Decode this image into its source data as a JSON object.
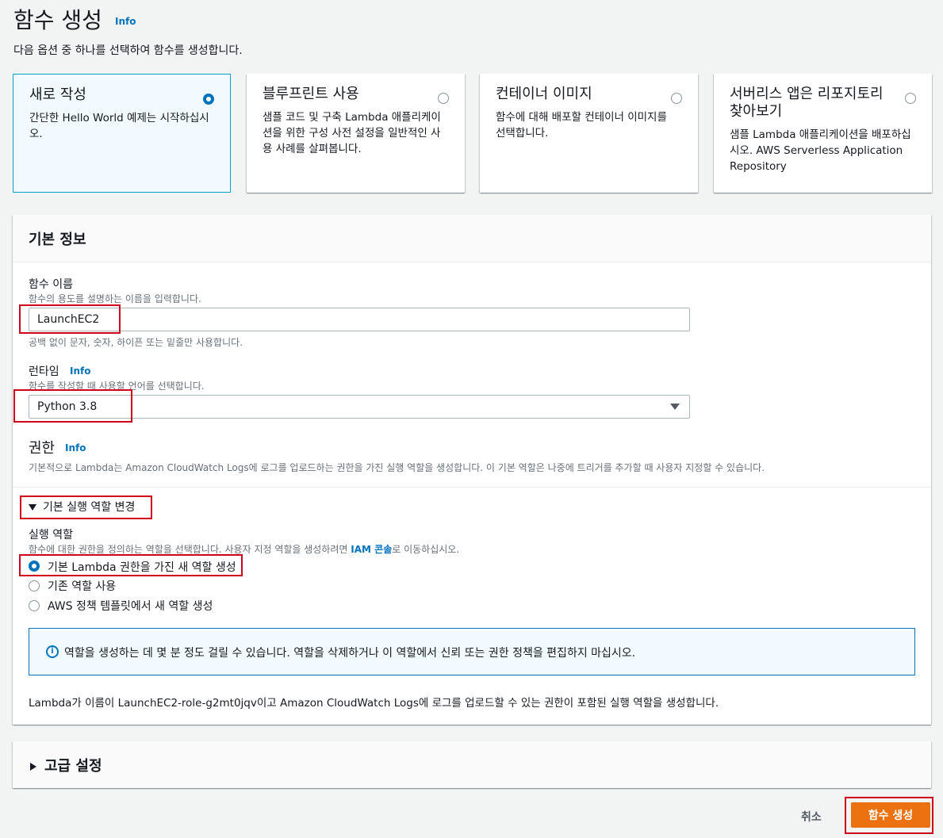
{
  "header": {
    "title": "함수 생성",
    "info": "Info",
    "description": "다음 옵션 중 하나를 선택하여 함수를 생성합니다."
  },
  "tiles": [
    {
      "title": "새로 작성",
      "desc": "간단한 Hello World 예제는 시작하십시오.",
      "selected": true
    },
    {
      "title": "블루프린트 사용",
      "desc": "샘플 코드 및 구축 Lambda 애플리케이션을 위한 구성 사전 설정을 일반적인 사용 사례를 살펴봅니다.",
      "selected": false
    },
    {
      "title": "컨테이너 이미지",
      "desc": "함수에 대해 배포할 컨테이너 이미지를 선택합니다.",
      "selected": false
    },
    {
      "title": "서버리스 앱은 리포지토리 찾아보기",
      "desc": "샘플 Lambda 애플리케이션을 배포하십시오. AWS Serverless Application Repository",
      "selected": false
    }
  ],
  "basic": {
    "title": "기본 정보",
    "name_label": "함수 이름",
    "name_desc": "함수의 용도를 설명하는 이름을 입력합니다.",
    "name_value": "LaunchEC2",
    "name_hint": "공백 없이 문자, 숫자, 하이픈 또는 밑줄만 사용합니다.",
    "runtime_label": "런타임",
    "runtime_info": "Info",
    "runtime_desc": "함수를 작성할 때 사용할 언어를 선택합니다.",
    "runtime_value": "Python 3.8",
    "perm_label": "권한",
    "perm_info": "Info",
    "perm_desc": "기본적으로 Lambda는 Amazon CloudWatch Logs에 로그를 업로드하는 권한을 가진 실행 역할을 생성합니다. 이 기본 역할은 나중에 트리거를 추가할 때 사용자 지정할 수 있습니다.",
    "expand_label": "기본 실행 역할 변경",
    "exec_label": "실행 역할",
    "exec_desc_pre": "함수에 대한 권한을 정의하는 역할을 선택합니다. 사용자 지정 역할을 생성하려면 ",
    "exec_desc_link": "IAM 콘솔",
    "exec_desc_post": "로 이동하십시오.",
    "options": [
      {
        "label": "기본 Lambda 권한을 가진 새 역할 생성",
        "selected": true
      },
      {
        "label": "기존 역할 사용",
        "selected": false
      },
      {
        "label": "AWS 정책 템플릿에서 새 역할 생성",
        "selected": false
      }
    ],
    "alert": "역할을 생성하는 데 몇 분 정도 걸릴 수 있습니다. 역할을 삭제하거나 이 역할에서 신뢰 또는 권한 정책을 편집하지 마십시오.",
    "footer_note": "Lambda가 이름이 LaunchEC2-role-g2mt0jqv이고 Amazon CloudWatch Logs에 로그를 업로드할 수 있는 권한이 포함된 실행 역할을 생성합니다."
  },
  "advanced": {
    "title": "고급 설정"
  },
  "actions": {
    "cancel": "취소",
    "create": "함수 생성"
  },
  "colors": {
    "primary": "#ec7211",
    "link": "#0073bb",
    "highlight": "#d0021b"
  }
}
